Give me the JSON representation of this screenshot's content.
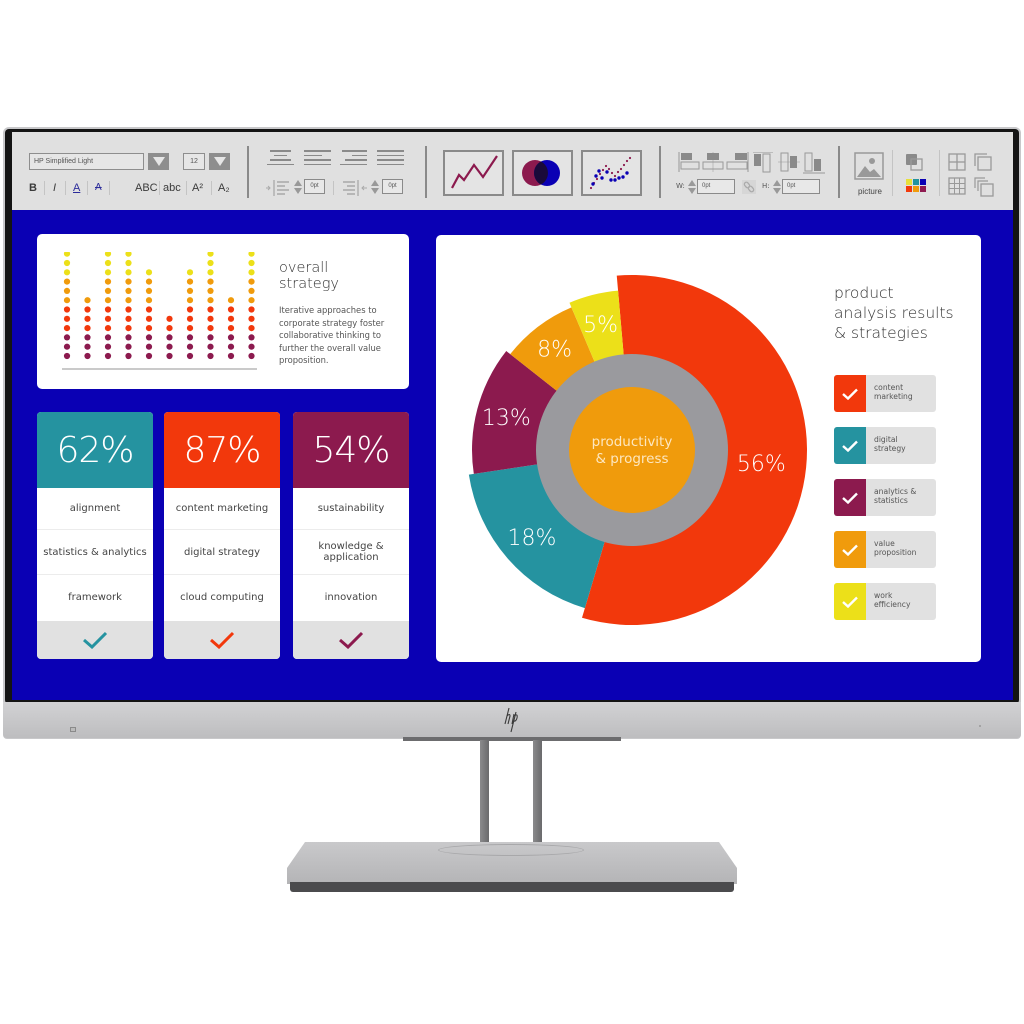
{
  "device": {
    "brand_logo": "hp-logo",
    "colors": {
      "frame": "#c8c8ca",
      "bezel": "#141414",
      "screen_bg": "#0a00b4"
    }
  },
  "toolbar": {
    "font_name": "HP Simplified Light",
    "font_size": "12",
    "format_buttons": [
      {
        "label": "B",
        "icon": "bold-icon"
      },
      {
        "label": "I",
        "icon": "italic-icon"
      },
      {
        "label": "A",
        "icon": "font-color-icon"
      },
      {
        "label": "A",
        "icon": "highlight-icon"
      },
      {
        "label": "ABC",
        "icon": "uppercase-icon"
      },
      {
        "label": "abc",
        "icon": "lowercase-icon"
      },
      {
        "label": "A²",
        "icon": "superscript-icon"
      },
      {
        "label": "A₂",
        "icon": "subscript-icon"
      }
    ],
    "alignment_buttons": [
      "align-center-icon",
      "align-left-icon",
      "align-right-icon",
      "align-justify-icon"
    ],
    "indent_left_value": "0pt",
    "indent_right_value": "0pt",
    "chart_buttons": [
      "line-chart-icon",
      "venn-diagram-icon",
      "scatter-chart-icon"
    ],
    "layout_buttons": [
      "align-top-left-icon",
      "align-top-center-icon",
      "align-top-right-icon",
      "align-left-tall-icon",
      "align-middle-tall-icon",
      "align-right-tall-icon"
    ],
    "width_label": "W:",
    "width_value": "0pt",
    "height_label": "H:",
    "height_value": "0pt",
    "picture_label": "picture",
    "palette_colors": [
      "#e8e03a",
      "#23939f",
      "#0a00b4",
      "#f23a0c",
      "#f09b0c",
      "#8f1b50"
    ]
  },
  "strategy_panel": {
    "title_line1": "overall",
    "title_line2": "strategy",
    "body": "Iterative approaches to corporate strategy foster collaborative thinking to further the overall value proposition."
  },
  "stat_cards": [
    {
      "value": "62%",
      "color": "#2593a0",
      "rows": [
        "alignment",
        "statistics & analytics",
        "framework"
      ]
    },
    {
      "value": "87%",
      "color": "#f2380c",
      "rows": [
        "content marketing",
        "digital strategy",
        "cloud computing"
      ]
    },
    {
      "value": "54%",
      "color": "#8c1a4e",
      "rows": [
        "sustainability",
        "knowledge & application",
        "innovation"
      ]
    }
  ],
  "analysis_panel": {
    "title_line1": "product",
    "title_line2": "analysis results",
    "title_line3": "& strategies",
    "center_line1": "productivity",
    "center_line2": "& progress",
    "legend": [
      {
        "label_line1": "content",
        "label_line2": "marketing",
        "color": "#f2380c"
      },
      {
        "label_line1": "digital",
        "label_line2": "strategy",
        "color": "#2593a0"
      },
      {
        "label_line1": "analytics &",
        "label_line2": "statistics",
        "color": "#8c1a4e"
      },
      {
        "label_line1": "value",
        "label_line2": "proposition",
        "color": "#f09b0c"
      },
      {
        "label_line1": "work",
        "label_line2": "efficiency",
        "color": "#ece019"
      }
    ]
  },
  "chart_data": [
    {
      "type": "pie",
      "title": "product analysis results & strategies",
      "center_label": "productivity & progress",
      "categories": [
        "content marketing",
        "digital strategy",
        "analytics & statistics",
        "value proposition",
        "work efficiency"
      ],
      "values": [
        56,
        18,
        13,
        8,
        5
      ],
      "data_labels": [
        "56%",
        "18%",
        "13%",
        "8%",
        "5%"
      ],
      "colors": [
        "#f2380c",
        "#2593a0",
        "#8c1a4e",
        "#f09b0c",
        "#ece019"
      ],
      "legend": "right"
    },
    {
      "type": "bar",
      "title": "overall strategy",
      "style": "dot-column",
      "categories": [
        "1",
        "2",
        "3",
        "4",
        "5",
        "6",
        "7",
        "8",
        "9",
        "10"
      ],
      "values": [
        12,
        7,
        12,
        12,
        10,
        5,
        10,
        12,
        7,
        12
      ],
      "ylim": [
        0,
        12
      ],
      "level_colors": [
        "#8c1a4e",
        "#8c1a4e",
        "#8c1a4e",
        "#f2380c",
        "#f2380c",
        "#f2380c",
        "#f09b0c",
        "#f09b0c",
        "#f09b0c",
        "#ece019",
        "#ece019",
        "#ece019"
      ]
    }
  ]
}
